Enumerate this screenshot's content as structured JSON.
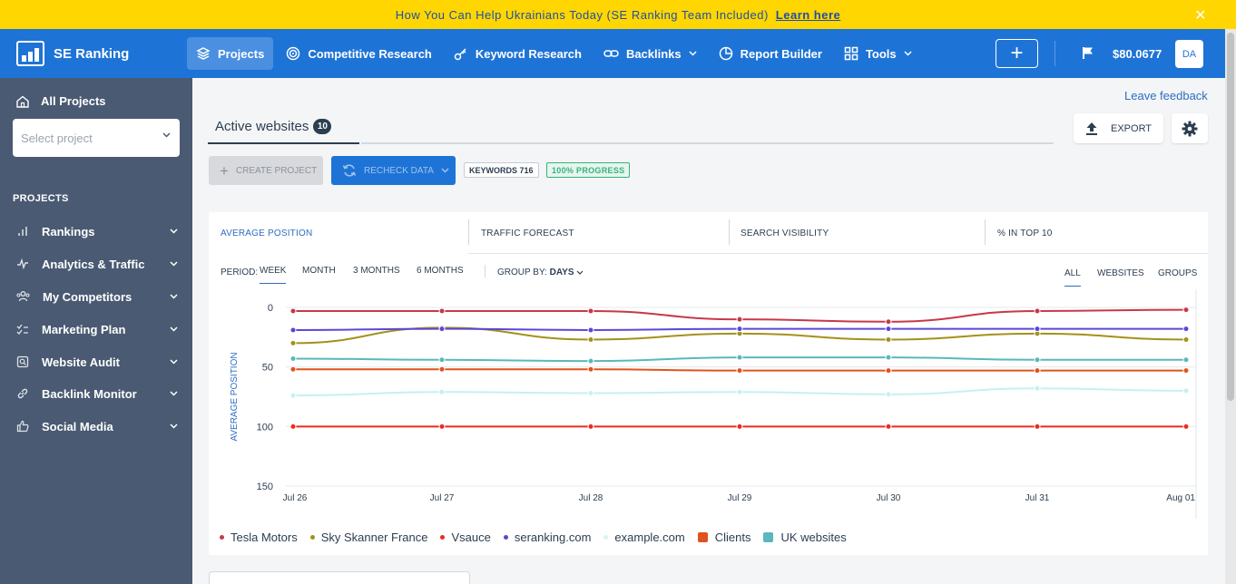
{
  "banner": {
    "text": "How You Can Help Ukrainians Today (SE Ranking Team Included)",
    "link": "Learn here",
    "close": "✕"
  },
  "brand": {
    "name": "SE Ranking"
  },
  "nav": {
    "items": [
      {
        "label": "Projects"
      },
      {
        "label": "Competitive Research"
      },
      {
        "label": "Keyword Research"
      },
      {
        "label": "Backlinks"
      },
      {
        "label": "Report Builder"
      },
      {
        "label": "Tools"
      }
    ],
    "add": "+",
    "balance": "$80.0677",
    "avatar": "DA"
  },
  "sidebar": {
    "all_projects": "All Projects",
    "select_placeholder": "Select project",
    "heading": "PROJECTS",
    "items": [
      {
        "label": "Rankings"
      },
      {
        "label": "Analytics & Traffic"
      },
      {
        "label": "My Competitors"
      },
      {
        "label": "Marketing Plan"
      },
      {
        "label": "Website Audit"
      },
      {
        "label": "Backlink Monitor"
      },
      {
        "label": "Social Media"
      }
    ]
  },
  "main": {
    "leave_feedback": "Leave feedback",
    "tab_label": "Active websites",
    "tab_count": "10",
    "export": "EXPORT",
    "create_project": "CREATE PROJECT",
    "recheck_data": "RECHECK DATA",
    "keywords_badge": "KEYWORDS 716",
    "progress_badge": "100%  PROGRESS"
  },
  "metric_tabs": [
    "AVERAGE POSITION",
    "TRAFFIC FORECAST",
    "SEARCH VISIBILITY",
    "% IN TOP 10"
  ],
  "filters": {
    "period_label": "PERIOD:",
    "periods": [
      "WEEK",
      "MONTH",
      "3 MONTHS",
      "6 MONTHS"
    ],
    "group_label": "GROUP BY:",
    "group_value": "DAYS",
    "views": [
      "ALL",
      "WEBSITES",
      "GROUPS"
    ]
  },
  "colors": {
    "accent": "#1e74d6",
    "banner": "#ffd600",
    "sidebar": "#495a72"
  },
  "chart_data": {
    "type": "line",
    "ylabel": "AVERAGE POSITION",
    "x": [
      "Jul 26",
      "Jul 27",
      "Jul 28",
      "Jul 29",
      "Jul 30",
      "Jul 31",
      "Aug 01"
    ],
    "y_ticks": [
      "0",
      "50",
      "100",
      "150"
    ],
    "ylim": [
      0,
      150
    ],
    "y_inverted": true,
    "grid": true,
    "legend_placement": "bottom",
    "series": [
      {
        "name": "Tesla Motors",
        "color": "#c9374a",
        "values": [
          3,
          3,
          3,
          10,
          12,
          3,
          2
        ]
      },
      {
        "name": "Sky Skanner France",
        "color": "#a4911a",
        "values": [
          30,
          17,
          27,
          22,
          27,
          22,
          27
        ]
      },
      {
        "name": "Vsauce",
        "color": "#ec2a1e",
        "values": [
          100,
          100,
          100,
          100,
          100,
          100,
          100
        ]
      },
      {
        "name": "seranking.com",
        "color": "#5a47d6",
        "values": [
          19,
          18,
          19,
          18,
          18,
          18,
          18
        ]
      },
      {
        "name": "example.com",
        "color": "#c4f1f1",
        "values": [
          74,
          71,
          72,
          71,
          73,
          68,
          70
        ]
      },
      {
        "name": "UK websites",
        "color": "#5ab7bd",
        "values": [
          43,
          44,
          45,
          42,
          42,
          44,
          44
        ]
      },
      {
        "name": "Clients",
        "color": "#e0531f",
        "values": [
          52,
          52,
          52,
          53,
          53,
          53,
          53
        ]
      }
    ],
    "legend": [
      {
        "name": "Tesla Motors",
        "color": "#c9374a",
        "shape": "dot"
      },
      {
        "name": "Sky Skanner France",
        "color": "#a4911a",
        "shape": "dot"
      },
      {
        "name": "Vsauce",
        "color": "#ec2a1e",
        "shape": "dot"
      },
      {
        "name": "seranking.com",
        "color": "#5a47d6",
        "shape": "dot"
      },
      {
        "name": "example.com",
        "color": "#d6f4f4",
        "shape": "dot"
      },
      {
        "name": "Clients",
        "color": "#e0531f",
        "shape": "square"
      },
      {
        "name": "UK websites",
        "color": "#5ab7bd",
        "shape": "square"
      }
    ]
  }
}
